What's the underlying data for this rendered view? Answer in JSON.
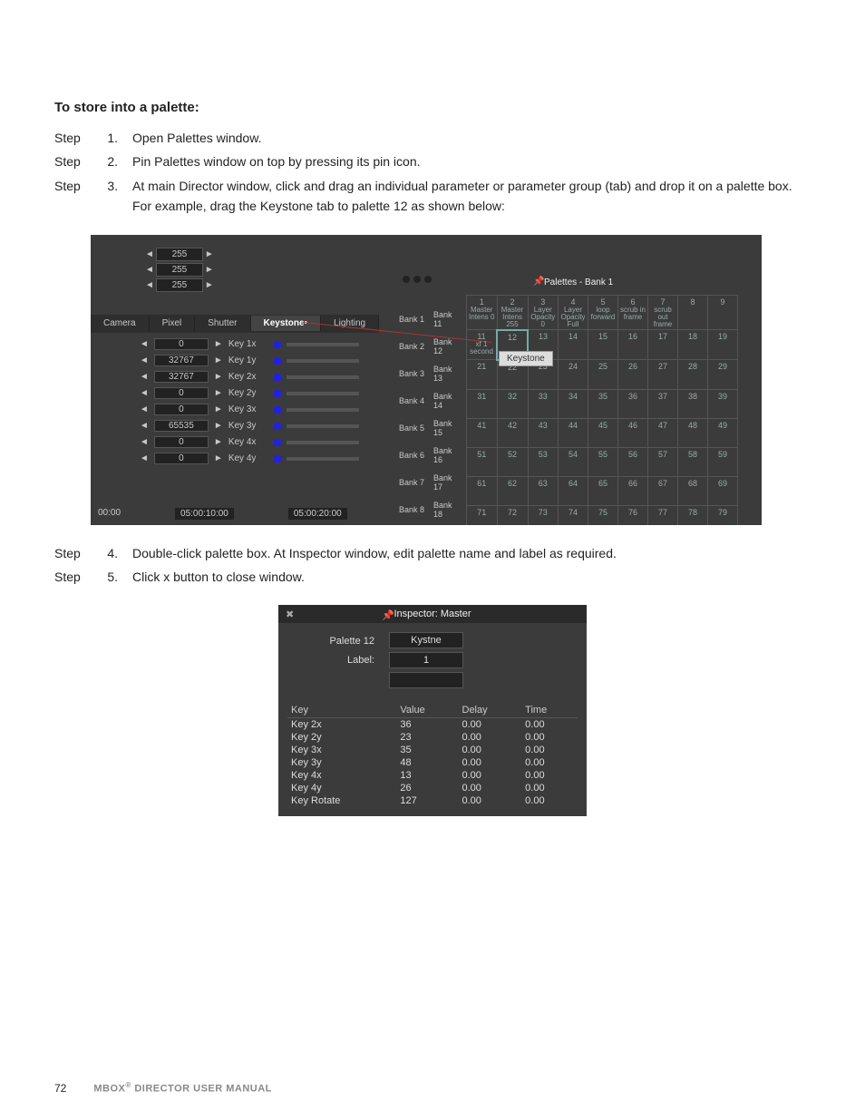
{
  "text": {
    "heading": "To store into a palette:",
    "steps": [
      {
        "lbl": "Step",
        "num": "1.",
        "txt": "Open Palettes window."
      },
      {
        "lbl": "Step",
        "num": "2.",
        "txt": "Pin Palettes window on top by pressing its pin icon."
      },
      {
        "lbl": "Step",
        "num": "3.",
        "txt": "At main Director window, click and drag an individual parameter or parameter group (tab) and drop it on a palette box. For example, drag the Keystone tab to palette 12 as shown below:"
      },
      {
        "lbl": "Step",
        "num": "4.",
        "txt": "Double-click palette box. At Inspector window, edit palette name and label as required."
      },
      {
        "lbl": "Step",
        "num": "5.",
        "txt": "Click x button to close window."
      }
    ],
    "footer_page": "72",
    "footer_book_a": "MBOX",
    "footer_book_b": " DIRECTOR USER MANUAL"
  },
  "shot1": {
    "pal_title": "Palettes - Bank 1",
    "spinners": [
      "255",
      "255",
      "255"
    ],
    "tabs": [
      "Camera",
      "Pixel",
      "Shutter",
      "Keystone",
      "Lighting"
    ],
    "key_rows": [
      {
        "val": "0",
        "lbl": "Key 1x"
      },
      {
        "val": "32767",
        "lbl": "Key 1y"
      },
      {
        "val": "32767",
        "lbl": "Key 2x"
      },
      {
        "val": "0",
        "lbl": "Key 2y"
      },
      {
        "val": "0",
        "lbl": "Key 3x"
      },
      {
        "val": "65535",
        "lbl": "Key 3y"
      },
      {
        "val": "0",
        "lbl": "Key 4x"
      },
      {
        "val": "0",
        "lbl": "Key 4y"
      }
    ],
    "timeline": [
      "00:00",
      "05:00:10:00",
      "05:00:20:00"
    ],
    "banks": [
      [
        "Bank 1",
        "Bank 11"
      ],
      [
        "Bank 2",
        "Bank 12"
      ],
      [
        "Bank 3",
        "Bank 13"
      ],
      [
        "Bank 4",
        "Bank 14"
      ],
      [
        "Bank 5",
        "Bank 15"
      ],
      [
        "Bank 6",
        "Bank 16"
      ],
      [
        "Bank 7",
        "Bank 17"
      ],
      [
        "Bank 8",
        "Bank 18"
      ]
    ],
    "grid_headers": [
      {
        "n": "1",
        "s": "Master Intens 0"
      },
      {
        "n": "2",
        "s": "Master Intens 255"
      },
      {
        "n": "3",
        "s": "Layer Opacity 0"
      },
      {
        "n": "4",
        "s": "Layer Opacity Full"
      },
      {
        "n": "5",
        "s": "loop forward"
      },
      {
        "n": "6",
        "s": "scrub in frame"
      },
      {
        "n": "7",
        "s": "scrub out frame"
      },
      {
        "n": "8",
        "s": ""
      },
      {
        "n": "9",
        "s": ""
      }
    ],
    "grid_rows": [
      [
        {
          "n": "11",
          "s": "xf 1 second"
        },
        {
          "n": "12",
          "s": ""
        },
        {
          "n": "13",
          "s": ""
        },
        {
          "n": "14",
          "s": ""
        },
        {
          "n": "15",
          "s": ""
        },
        {
          "n": "16",
          "s": ""
        },
        {
          "n": "17",
          "s": ""
        },
        {
          "n": "18",
          "s": ""
        },
        {
          "n": "19",
          "s": ""
        }
      ],
      [
        {
          "n": "21",
          "s": ""
        },
        {
          "n": "22",
          "s": ""
        },
        {
          "n": "23",
          "s": ""
        },
        {
          "n": "24",
          "s": ""
        },
        {
          "n": "25",
          "s": ""
        },
        {
          "n": "26",
          "s": ""
        },
        {
          "n": "27",
          "s": ""
        },
        {
          "n": "28",
          "s": ""
        },
        {
          "n": "29",
          "s": ""
        }
      ],
      [
        {
          "n": "31",
          "s": ""
        },
        {
          "n": "32",
          "s": ""
        },
        {
          "n": "33",
          "s": ""
        },
        {
          "n": "34",
          "s": ""
        },
        {
          "n": "35",
          "s": ""
        },
        {
          "n": "36",
          "s": ""
        },
        {
          "n": "37",
          "s": ""
        },
        {
          "n": "38",
          "s": ""
        },
        {
          "n": "39",
          "s": ""
        }
      ],
      [
        {
          "n": "41",
          "s": ""
        },
        {
          "n": "42",
          "s": ""
        },
        {
          "n": "43",
          "s": ""
        },
        {
          "n": "44",
          "s": ""
        },
        {
          "n": "45",
          "s": ""
        },
        {
          "n": "46",
          "s": ""
        },
        {
          "n": "47",
          "s": ""
        },
        {
          "n": "48",
          "s": ""
        },
        {
          "n": "49",
          "s": ""
        }
      ],
      [
        {
          "n": "51",
          "s": ""
        },
        {
          "n": "52",
          "s": ""
        },
        {
          "n": "53",
          "s": ""
        },
        {
          "n": "54",
          "s": ""
        },
        {
          "n": "55",
          "s": ""
        },
        {
          "n": "56",
          "s": ""
        },
        {
          "n": "57",
          "s": ""
        },
        {
          "n": "58",
          "s": ""
        },
        {
          "n": "59",
          "s": ""
        }
      ],
      [
        {
          "n": "61",
          "s": ""
        },
        {
          "n": "62",
          "s": ""
        },
        {
          "n": "63",
          "s": ""
        },
        {
          "n": "64",
          "s": ""
        },
        {
          "n": "65",
          "s": ""
        },
        {
          "n": "66",
          "s": ""
        },
        {
          "n": "67",
          "s": ""
        },
        {
          "n": "68",
          "s": ""
        },
        {
          "n": "69",
          "s": ""
        }
      ],
      [
        {
          "n": "71",
          "s": ""
        },
        {
          "n": "72",
          "s": ""
        },
        {
          "n": "73",
          "s": ""
        },
        {
          "n": "74",
          "s": ""
        },
        {
          "n": "75",
          "s": ""
        },
        {
          "n": "76",
          "s": ""
        },
        {
          "n": "77",
          "s": ""
        },
        {
          "n": "78",
          "s": ""
        },
        {
          "n": "79",
          "s": ""
        }
      ]
    ],
    "drag_tooltip": "Keystone"
  },
  "shot2": {
    "title": "Inspector: Master",
    "label_name": "Palette 12",
    "label_label": "Label:",
    "input_name": "Kystne",
    "input_label": "1",
    "cols": [
      "Key",
      "Value",
      "Delay",
      "Time"
    ],
    "rows": [
      [
        "Key 2x",
        "36",
        "0.00",
        "0.00"
      ],
      [
        "Key 2y",
        "23",
        "0.00",
        "0.00"
      ],
      [
        "Key 3x",
        "35",
        "0.00",
        "0.00"
      ],
      [
        "Key 3y",
        "48",
        "0.00",
        "0.00"
      ],
      [
        "Key 4x",
        "13",
        "0.00",
        "0.00"
      ],
      [
        "Key 4y",
        "26",
        "0.00",
        "0.00"
      ],
      [
        "Key Rotate",
        "127",
        "0.00",
        "0.00"
      ]
    ]
  }
}
